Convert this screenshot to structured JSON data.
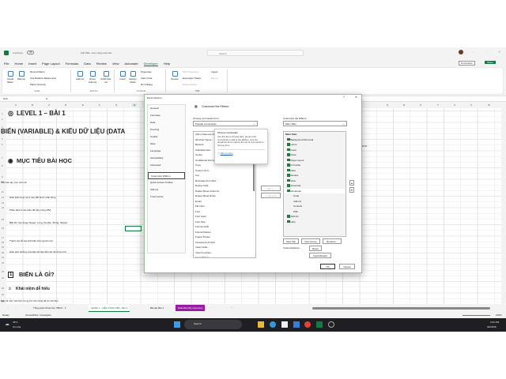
{
  "titlebar": {
    "autosave": "AutoSave",
    "autosave_state": "Off",
    "filename": "Full VBA - Học cùng Lear.xlsx",
    "search": "Search",
    "comments": "Comments",
    "share": "Share"
  },
  "ribbon_tabs": [
    "File",
    "Home",
    "Insert",
    "Page Layout",
    "Formulas",
    "Data",
    "Review",
    "View",
    "Automate",
    "Developer",
    "Help"
  ],
  "active_tab": "Developer",
  "ribbon": {
    "code": {
      "label": "Code",
      "visual_basic": "Visual Basic",
      "macros": "Macros",
      "record_macro": "Record Macro",
      "relative": "Use Relative References",
      "security": "Macro Security"
    },
    "addins": {
      "label": "Add-ins",
      "addins": "Add-ins",
      "excel_addins": "Excel Add-ins",
      "com_addins": "COM Add-ins"
    },
    "controls": {
      "label": "Controls",
      "insert": "Insert",
      "design_mode": "Design Mode",
      "properties": "Properties",
      "view_code": "View Code",
      "run_dialog": "Run Dialog"
    },
    "xml": {
      "label": "XML",
      "source": "Source",
      "map_properties": "Map Properties",
      "expansion_packs": "Expansion Packs",
      "refresh_data": "Refresh Data",
      "import": "Import",
      "export": "Export"
    }
  },
  "formula_bar": {
    "name_box": "H16",
    "fx": "fx"
  },
  "columns_left": [
    "A",
    "B",
    "C",
    "D",
    "E",
    "F",
    "G",
    "H"
  ],
  "columns_right": [
    "Q",
    "R",
    "S",
    "T",
    "U",
    "V",
    "W"
  ],
  "rows": [
    "1",
    "2",
    "3",
    "4",
    "5",
    "6",
    "7",
    "8",
    "9",
    "10",
    "11",
    "12",
    "13",
    "14",
    "15",
    "16",
    "17",
    "18",
    "19",
    "20",
    "21",
    "22",
    "23",
    "24",
    "25",
    "26",
    "27"
  ],
  "sheet": {
    "level": "LEVEL 1 – BÀI 1",
    "subtitle": "BIẾN (VARIABLE) & KIỂU DỮ LIỆU (DATA",
    "goal_title": "MỤC TIÊU BÀI HỌC",
    "intro": "Sau bài này, học viên sẽ:",
    "g1": "Hiểu biến là gì và vì sao bắt buộc phải dùng",
    "g2": "Phân biệt rõ các kiểu dữ liệu trong VBA",
    "g3": "Biết khi nào dùng Integer, Long, Double, String, Variant",
    "g4": "Tránh các lỗi sai phổ biến của người mới",
    "g5": "Hiểu ảnh hưởng của kiểu dữ liệu đến tốc độ & bộ nhớ",
    "right_fragment": "chính",
    "s1_num": "1",
    "s1_title": "BIẾN LÀ GÌ?",
    "concept": "Khái niệm dễ hiểu",
    "concept_text": "Biến là một \"cái hộp\" trong bộ nhớ dùng để lưu dữ liệu."
  },
  "sheet_tabs": [
    "Tổng quan Khóa học VBA 0 - 1",
    "LEVEL 1 - NỀN TẢNG VBA - Bài 1",
    "Bài tập Bài 1",
    "Data Monthly expenses"
  ],
  "active_sheet": 1,
  "status": {
    "ready": "Ready",
    "accessibility": "Accessibility: Investigate",
    "zoom": "100%"
  },
  "dialog": {
    "title": "Excel Options",
    "help": "?",
    "close": "✕",
    "nav": [
      "General",
      "Formulas",
      "Data",
      "Proofing",
      "Copilot",
      "Save",
      "Language",
      "Accessibility",
      "Advanced",
      "Customize Ribbon",
      "Quick Access Toolbar",
      "Add-ins",
      "Trust Center"
    ],
    "selected_nav": "Customize Ribbon",
    "heading": "Customize the Ribbon.",
    "choose_label": "Choose commands from:",
    "choose_value": "Popular Commands",
    "customize_label": "Customize the Ribbon:",
    "customize_value": "Main Tabs",
    "commands": [
      "Add or Remove Filters",
      "All Chart Types...",
      "Borders",
      "Calculate Now",
      "Center",
      "Conditional Formatting",
      "Copy",
      "Custom Sort...",
      "Cut",
      "Decrease Font Size",
      "Delete Cells...",
      "Delete Sheet Columns",
      "Delete Sheet Rows",
      "Email",
      "Fill Color",
      "Font",
      "Font Color",
      "Font Size",
      "Format Cells",
      "Format Painter",
      "Freeze Panes",
      "Increase Font Size",
      "Insert Cells...",
      "Insert Function...",
      "Insert Picture"
    ],
    "add": "Add >>",
    "remove": "<< Remove",
    "tree_header": "Main Tabs",
    "tree": [
      "Background Removal",
      "Home",
      "Insert",
      "Draw",
      "Page Layout",
      "Formulas",
      "Data",
      "Review",
      "View",
      "Automate",
      "Developer"
    ],
    "dev_children": [
      "Code",
      "Add-ins",
      "Controls",
      "XML"
    ],
    "tree_after": [
      "Add-ins",
      "Help"
    ],
    "new_tab": "New Tab",
    "new_group": "New Group",
    "rename": "Rename...",
    "customizations": "Customizations:",
    "reset": "Reset",
    "import_export": "Import/Export",
    "ok": "OK",
    "cancel": "Cancel",
    "tooltip": {
      "title": "Choose commands",
      "body": "Use this list to choose tabs, groups and commands to add to the Ribbon. Use the dropdown list to narrow the set of commands to choose from.",
      "link": "Tell me more"
    }
  },
  "taskbar": {
    "temp": "33°C",
    "weather": "Có mây",
    "search": "Search",
    "time": "3:31 PM",
    "date": "02/25/26"
  }
}
